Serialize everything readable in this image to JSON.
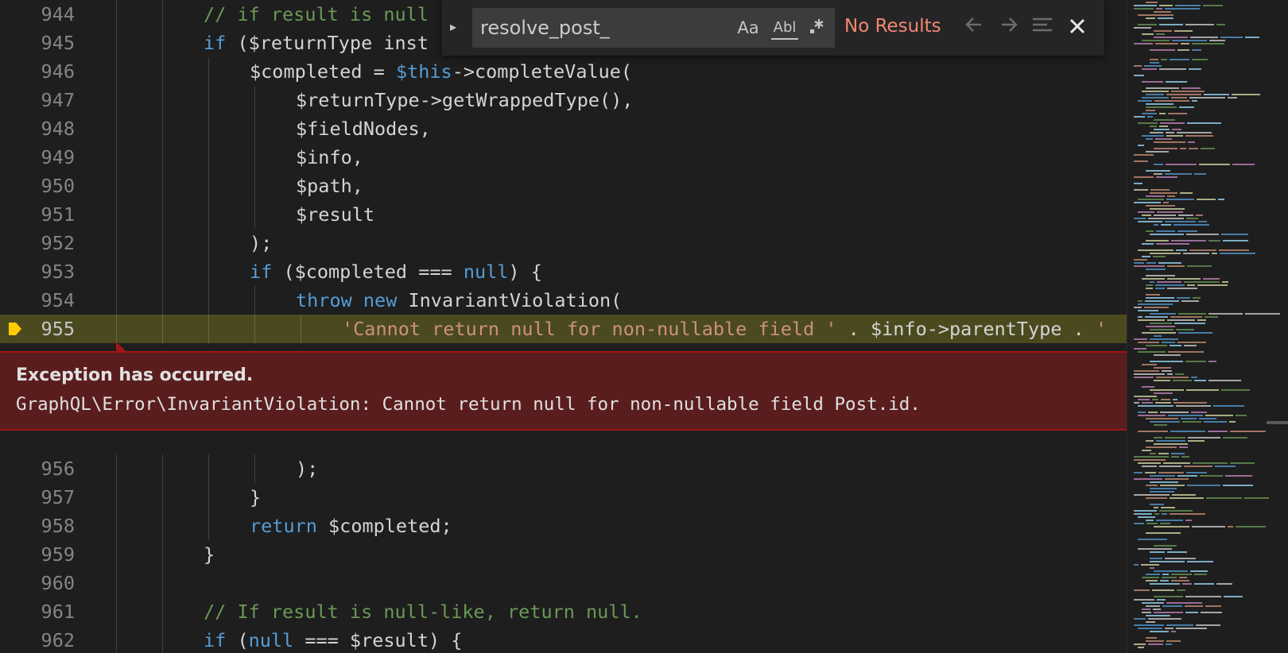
{
  "editor": {
    "lines_top": [
      {
        "num": "944",
        "indent": 2,
        "tokens": [
          {
            "t": "// if result is null",
            "c": "com"
          }
        ]
      },
      {
        "num": "945",
        "indent": 2,
        "tokens": [
          {
            "t": "if",
            "c": "kw"
          },
          {
            "t": " ($returnType inst",
            "c": "var"
          }
        ]
      },
      {
        "num": "946",
        "indent": 3,
        "tokens": [
          {
            "t": "$completed = ",
            "c": "var"
          },
          {
            "t": "$this",
            "c": "this"
          },
          {
            "t": "->completeValue(",
            "c": "var"
          }
        ]
      },
      {
        "num": "947",
        "indent": 4,
        "tokens": [
          {
            "t": "$returnType->getWrappedType(),",
            "c": "var"
          }
        ]
      },
      {
        "num": "948",
        "indent": 4,
        "tokens": [
          {
            "t": "$fieldNodes,",
            "c": "var"
          }
        ]
      },
      {
        "num": "949",
        "indent": 4,
        "tokens": [
          {
            "t": "$info,",
            "c": "var"
          }
        ]
      },
      {
        "num": "950",
        "indent": 4,
        "tokens": [
          {
            "t": "$path,",
            "c": "var"
          }
        ]
      },
      {
        "num": "951",
        "indent": 4,
        "tokens": [
          {
            "t": "$result",
            "c": "var"
          }
        ]
      },
      {
        "num": "952",
        "indent": 3,
        "tokens": [
          {
            "t": ");",
            "c": "var"
          }
        ]
      },
      {
        "num": "953",
        "indent": 3,
        "tokens": [
          {
            "t": "if",
            "c": "kw"
          },
          {
            "t": " ($completed === ",
            "c": "var"
          },
          {
            "t": "null",
            "c": "kw"
          },
          {
            "t": ") {",
            "c": "var"
          }
        ]
      },
      {
        "num": "954",
        "indent": 4,
        "tokens": [
          {
            "t": "throw",
            "c": "kw"
          },
          {
            "t": " ",
            "c": "var"
          },
          {
            "t": "new",
            "c": "kw"
          },
          {
            "t": " InvariantViolation(",
            "c": "var"
          }
        ]
      },
      {
        "num": "955",
        "indent": 5,
        "highlight": true,
        "tokens": [
          {
            "t": "'Cannot return null for non-nullable field '",
            "c": "str"
          },
          {
            "t": " . $info->parentType . ",
            "c": "var"
          },
          {
            "t": "'",
            "c": "str"
          }
        ]
      }
    ],
    "lines_bottom": [
      {
        "num": "956",
        "indent": 4,
        "tokens": [
          {
            "t": ");",
            "c": "var"
          }
        ]
      },
      {
        "num": "957",
        "indent": 3,
        "tokens": [
          {
            "t": "}",
            "c": "var"
          }
        ]
      },
      {
        "num": "958",
        "indent": 3,
        "tokens": [
          {
            "t": "return",
            "c": "kw"
          },
          {
            "t": " $completed;",
            "c": "var"
          }
        ]
      },
      {
        "num": "959",
        "indent": 2,
        "tokens": [
          {
            "t": "}",
            "c": "var"
          }
        ]
      },
      {
        "num": "960",
        "indent": 2,
        "tokens": []
      },
      {
        "num": "961",
        "indent": 2,
        "tokens": [
          {
            "t": "// If result is null-like, return null.",
            "c": "com"
          }
        ]
      },
      {
        "num": "962",
        "indent": 2,
        "tokens": [
          {
            "t": "if",
            "c": "kw"
          },
          {
            "t": " (",
            "c": "var"
          },
          {
            "t": "null",
            "c": "kw"
          },
          {
            "t": " === $result) {",
            "c": "var"
          }
        ]
      }
    ]
  },
  "exception": {
    "title": "Exception has occurred.",
    "message": "GraphQL\\Error\\InvariantViolation: Cannot return null for non-nullable field Post.id."
  },
  "find": {
    "value": "resolve_post_",
    "match_case_label": "Aa",
    "whole_word_label": "Abl",
    "regex_label": ".*",
    "result_text": "No Results",
    "prev_icon": "arrow-up-icon",
    "next_icon": "arrow-down-icon",
    "selection_icon": "find-in-selection-icon",
    "close_icon": "close-icon"
  },
  "colors": {
    "background": "#1e1e1e",
    "keyword": "#569cd6",
    "comment": "#6a9955",
    "string": "#ce9178",
    "exception_bg": "#5a1d1d",
    "highlight_line": "#4b4a1f",
    "no_results": "#f48771"
  }
}
